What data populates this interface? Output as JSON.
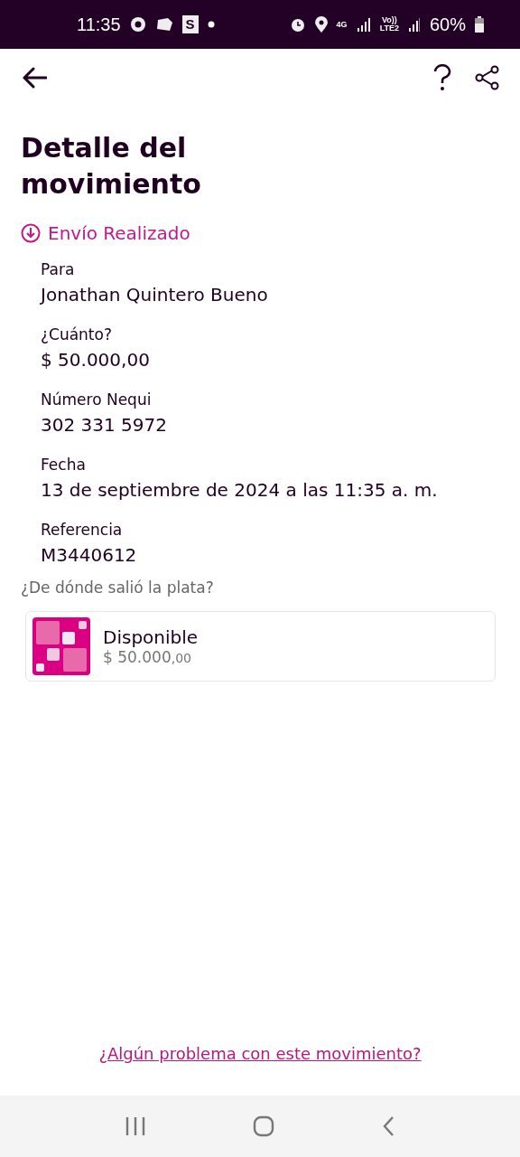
{
  "status_bar": {
    "time": "11:35",
    "app_badge": "S",
    "network": "4G",
    "volte": "Vo))",
    "lte": "LTE2",
    "battery": "60%"
  },
  "header": {
    "title": "Detalle del movimiento"
  },
  "status": {
    "label": "Envío Realizado"
  },
  "fields": [
    {
      "label": "Para",
      "value": "Jonathan Quintero Bueno"
    },
    {
      "label": "¿Cuánto?",
      "value": "$ 50.000,00"
    },
    {
      "label": "Número Nequi",
      "value": "302 331 5972"
    },
    {
      "label": "Fecha",
      "value": "13 de septiembre de 2024 a las 11:35 a. m."
    },
    {
      "label": "Referencia",
      "value": "M3440612"
    }
  ],
  "source": {
    "question": "¿De dónde salió la plata?",
    "account": "Disponible",
    "amount": "$ 50.000",
    "cents": ",00"
  },
  "help_link": "¿Algún problema con este movimiento?"
}
